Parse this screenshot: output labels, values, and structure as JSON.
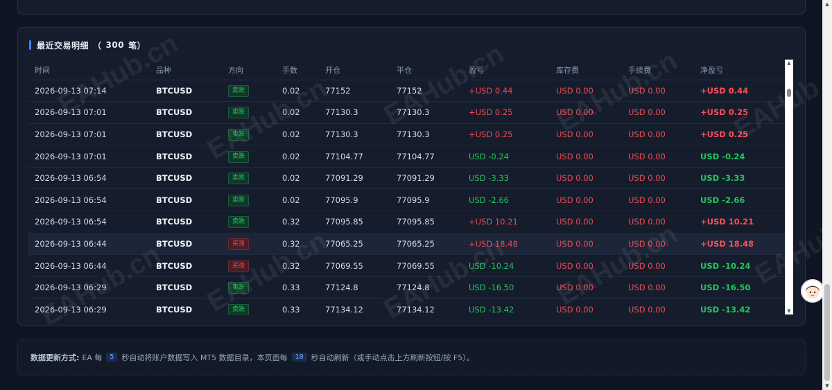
{
  "trades": {
    "title_prefix": "最近交易明细",
    "title_open": "（",
    "count": "300",
    "count_unit": "笔）",
    "columns": [
      "时间",
      "品种",
      "方向",
      "手数",
      "开仓",
      "平仓",
      "盈亏",
      "库存费",
      "手续费",
      "净盈亏"
    ],
    "rows": [
      {
        "time": "2026-09-13 07:14",
        "symbol": "BTCUSD",
        "side": "卖跌",
        "lots": "0.02",
        "open": "77152",
        "close": "77152",
        "pnl": "+USD 0.44",
        "swap": "USD 0.00",
        "fee": "USD 0.00",
        "net": "+USD 0.44"
      },
      {
        "time": "2026-09-13 07:01",
        "symbol": "BTCUSD",
        "side": "卖跌",
        "lots": "0.02",
        "open": "77130.3",
        "close": "77130.3",
        "pnl": "+USD 0.25",
        "swap": "USD 0.00",
        "fee": "USD 0.00",
        "net": "+USD 0.25"
      },
      {
        "time": "2026-09-13 07:01",
        "symbol": "BTCUSD",
        "side": "卖跌",
        "lots": "0.02",
        "open": "77130.3",
        "close": "77130.3",
        "pnl": "+USD 0.25",
        "swap": "USD 0.00",
        "fee": "USD 0.00",
        "net": "+USD 0.25"
      },
      {
        "time": "2026-09-13 07:01",
        "symbol": "BTCUSD",
        "side": "卖跌",
        "lots": "0.02",
        "open": "77104.77",
        "close": "77104.77",
        "pnl": "USD -0.24",
        "swap": "USD 0.00",
        "fee": "USD 0.00",
        "net": "USD -0.24"
      },
      {
        "time": "2026-09-13 06:54",
        "symbol": "BTCUSD",
        "side": "卖跌",
        "lots": "0.02",
        "open": "77091.29",
        "close": "77091.29",
        "pnl": "USD -3.33",
        "swap": "USD 0.00",
        "fee": "USD 0.00",
        "net": "USD -3.33"
      },
      {
        "time": "2026-09-13 06:54",
        "symbol": "BTCUSD",
        "side": "卖跌",
        "lots": "0.02",
        "open": "77095.9",
        "close": "77095.9",
        "pnl": "USD -2.66",
        "swap": "USD 0.00",
        "fee": "USD 0.00",
        "net": "USD -2.66"
      },
      {
        "time": "2026-09-13 06:54",
        "symbol": "BTCUSD",
        "side": "卖跌",
        "lots": "0.32",
        "open": "77095.85",
        "close": "77095.85",
        "pnl": "+USD 10.21",
        "swap": "USD 0.00",
        "fee": "USD 0.00",
        "net": "+USD 10.21"
      },
      {
        "time": "2026-09-13 06:44",
        "symbol": "BTCUSD",
        "side": "买涨",
        "lots": "0.32",
        "open": "77065.25",
        "close": "77065.25",
        "pnl": "+USD 18.48",
        "swap": "USD 0.00",
        "fee": "USD 0.00",
        "net": "+USD 18.48"
      },
      {
        "time": "2026-09-13 06:44",
        "symbol": "BTCUSD",
        "side": "买涨",
        "lots": "0.32",
        "open": "77069.55",
        "close": "77069.55",
        "pnl": "USD -10.24",
        "swap": "USD 0.00",
        "fee": "USD 0.00",
        "net": "USD -10.24"
      },
      {
        "time": "2026-09-13 06:29",
        "symbol": "BTCUSD",
        "side": "卖跌",
        "lots": "0.33",
        "open": "77124.8",
        "close": "77124.8",
        "pnl": "USD -16.50",
        "swap": "USD 0.00",
        "fee": "USD 0.00",
        "net": "USD -16.50"
      },
      {
        "time": "2026-09-13 06:29",
        "symbol": "BTCUSD",
        "side": "卖跌",
        "lots": "0.33",
        "open": "77134.12",
        "close": "77134.12",
        "pnl": "USD -13.42",
        "swap": "USD 0.00",
        "fee": "USD 0.00",
        "net": "USD -13.42"
      }
    ]
  },
  "info": {
    "label": "数据更新方式:",
    "part1": "EA 每",
    "ea_seconds": "5",
    "part2": "秒自动将账户数据写入 MT5 数据目录，本页面每",
    "page_seconds": "10",
    "part3": "秒自动刷新（或手动点击上方刷新按钮/按 F5）。"
  },
  "watermark": "EAHub.cn",
  "colors": {
    "accent": "#3b82f6",
    "profit": "#ef4b55",
    "loss": "#22c55e",
    "background": "#0f1522",
    "card": "#151d2c"
  },
  "icons": {
    "avatar": "support-avatar-icon",
    "scroll_up": "triangle-up",
    "scroll_down": "triangle-down"
  }
}
